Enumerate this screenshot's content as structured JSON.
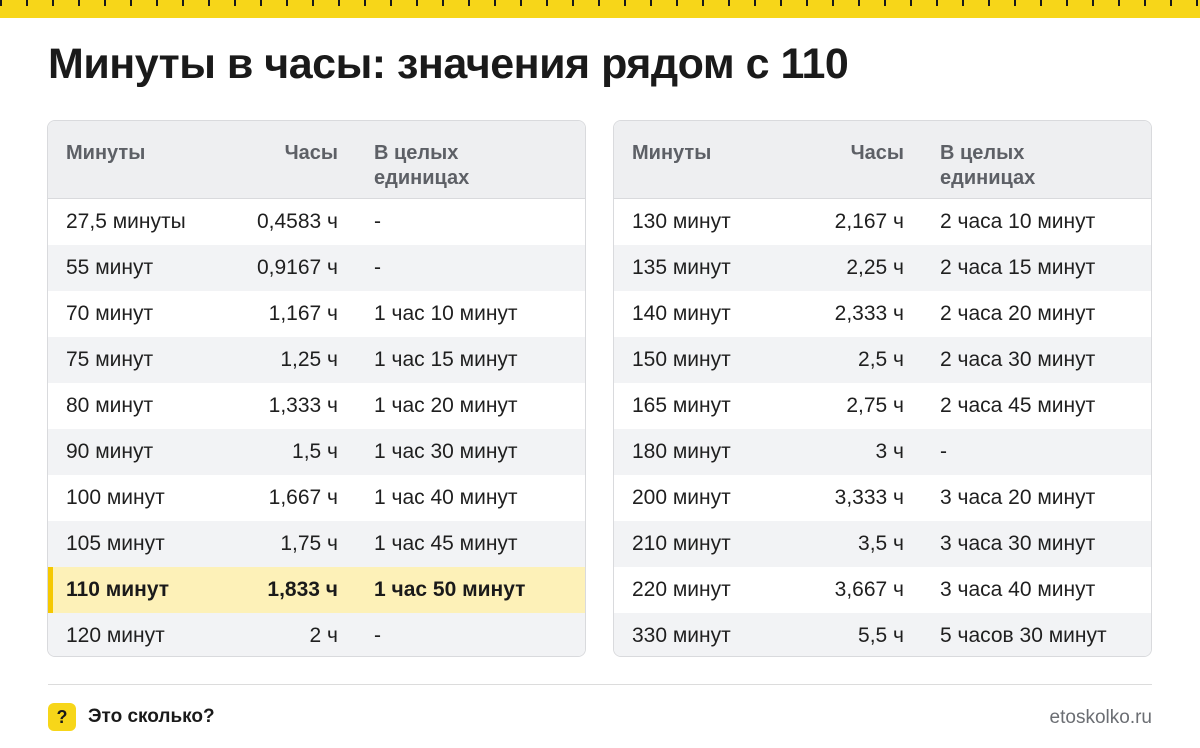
{
  "title": "Минуты в часы: значения рядом с 110",
  "headers": {
    "minutes": "Минуты",
    "hours": "Часы",
    "whole_line1": "В целых",
    "whole_line2": "единицах"
  },
  "left_rows": [
    {
      "minutes": "27,5 минуты",
      "hours": "0,4583 ч",
      "whole": "-"
    },
    {
      "minutes": "55 минут",
      "hours": "0,9167 ч",
      "whole": "-"
    },
    {
      "minutes": "70 минут",
      "hours": "1,167 ч",
      "whole": "1 час 10 минут"
    },
    {
      "minutes": "75 минут",
      "hours": "1,25 ч",
      "whole": "1 час 15 минут"
    },
    {
      "minutes": "80 минут",
      "hours": "1,333 ч",
      "whole": "1 час 20 минут"
    },
    {
      "minutes": "90 минут",
      "hours": "1,5 ч",
      "whole": "1 час 30 минут"
    },
    {
      "minutes": "100 минут",
      "hours": "1,667 ч",
      "whole": "1 час 40 минут"
    },
    {
      "minutes": "105 минут",
      "hours": "1,75 ч",
      "whole": "1 час 45 минут"
    },
    {
      "minutes": "110 минут",
      "hours": "1,833 ч",
      "whole": "1 час 50 минут"
    },
    {
      "minutes": "120 минут",
      "hours": "2 ч",
      "whole": "-"
    }
  ],
  "right_rows": [
    {
      "minutes": "130 минут",
      "hours": "2,167 ч",
      "whole": "2 часа 10 минут"
    },
    {
      "minutes": "135 минут",
      "hours": "2,25 ч",
      "whole": "2 часа 15 минут"
    },
    {
      "minutes": "140 минут",
      "hours": "2,333 ч",
      "whole": "2 часа 20 минут"
    },
    {
      "minutes": "150 минут",
      "hours": "2,5 ч",
      "whole": "2 часа 30 минут"
    },
    {
      "minutes": "165 минут",
      "hours": "2,75 ч",
      "whole": "2 часа 45 минут"
    },
    {
      "minutes": "180 минут",
      "hours": "3 ч",
      "whole": "-"
    },
    {
      "minutes": "200 минут",
      "hours": "3,333 ч",
      "whole": "3 часа 20 минут"
    },
    {
      "minutes": "210 минут",
      "hours": "3,5 ч",
      "whole": "3 часа 30 минут"
    },
    {
      "minutes": "220 минут",
      "hours": "3,667 ч",
      "whole": "3 часа 40 минут"
    },
    {
      "minutes": "330 минут",
      "hours": "5,5 ч",
      "whole": "5 часов 30 минут"
    }
  ],
  "footer": {
    "badge": "?",
    "brand": "Это сколько?",
    "site": "etoskolko.ru"
  },
  "colors": {
    "accent": "#f7d619",
    "highlight_bg": "#fdf1b8",
    "header_bg": "#eeeff1"
  }
}
